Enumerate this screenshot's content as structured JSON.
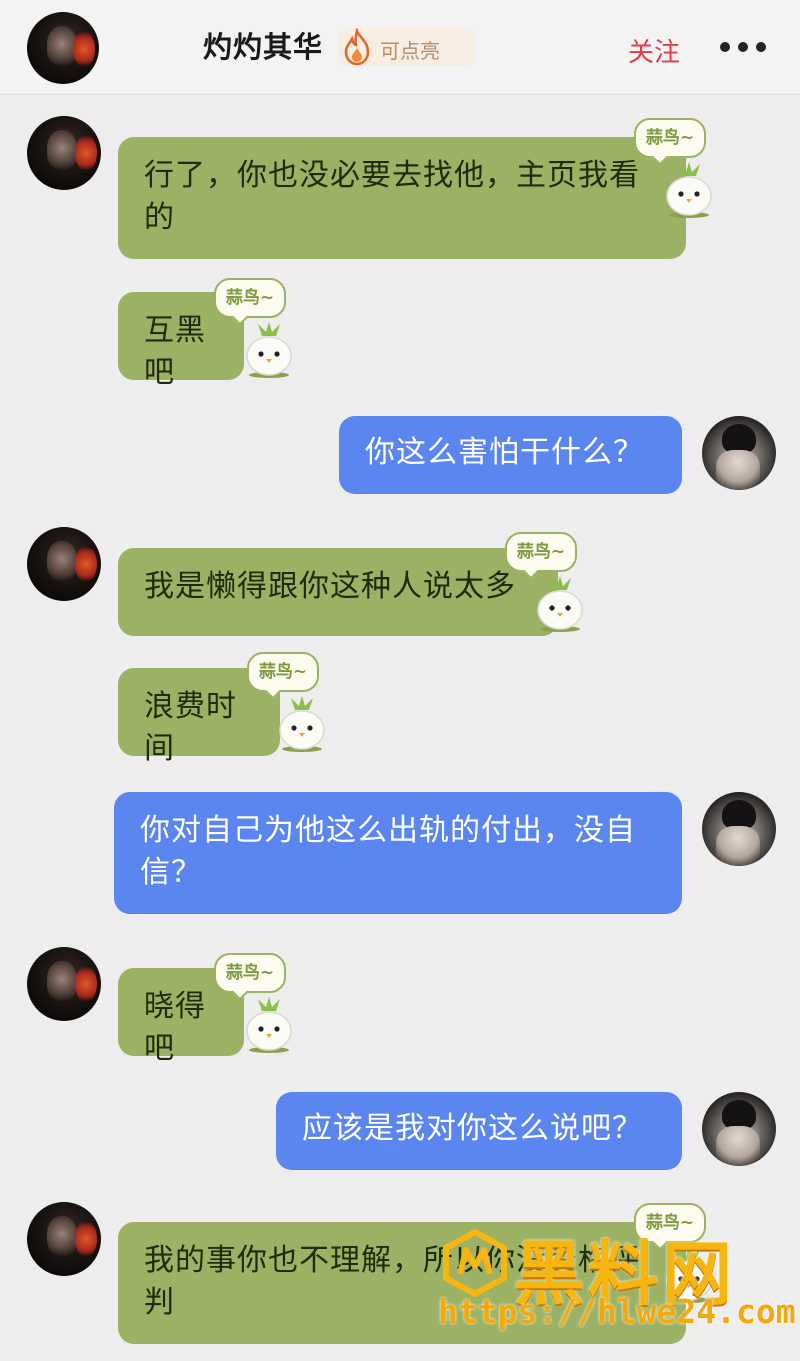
{
  "header": {
    "contact_name": "灼灼其华",
    "light_label": "可点亮",
    "follow_label": "关注",
    "back_icon": "chevron-left-icon",
    "more_icon": "more-dots-icon"
  },
  "sticker_text": "蒜鸟~",
  "messages": [
    {
      "side": "in",
      "text": "行了，你也没必要去找他，主页我看的"
    },
    {
      "side": "in",
      "text": "互黑吧"
    },
    {
      "side": "out",
      "text": "你这么害怕干什么？"
    },
    {
      "side": "in",
      "text": "我是懒得跟你这种人说太多"
    },
    {
      "side": "in",
      "text": "浪费时间"
    },
    {
      "side": "out",
      "text": "你对自己为他这么出轨的付出，没自信？"
    },
    {
      "side": "in",
      "text": "晓得吧"
    },
    {
      "side": "out",
      "text": "应该是我对你这么说吧？"
    },
    {
      "side": "in",
      "text": "我的事你也不理解，所以你没资格评判"
    }
  ],
  "watermark": {
    "title": "黑料网",
    "url": "https://hlwe24.com"
  },
  "colors": {
    "incoming_bubble": "#9bb163",
    "outgoing_bubble": "#5b86ef",
    "follow": "#e23c4b",
    "watermark": "#f7b512"
  }
}
